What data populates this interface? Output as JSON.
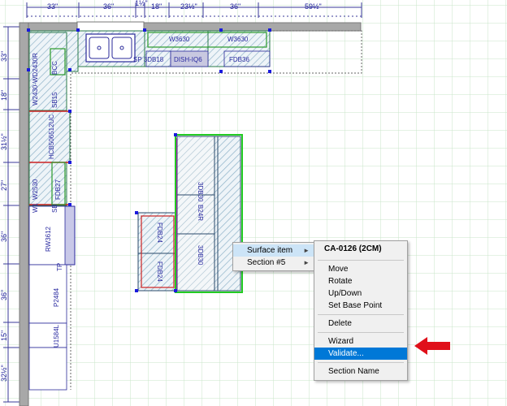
{
  "dimensions_top": [
    "33\"",
    "36\"",
    "1½\"",
    "18\"",
    "23½\"",
    "36\"",
    "59½\""
  ],
  "dimensions_left": [
    "33\"",
    "18\"",
    "31½\"",
    "27\"",
    "36\"",
    "36\"",
    "15\"",
    "32½\""
  ],
  "cabinets": {
    "wall_1": "W3630",
    "wall_2": "W3630",
    "base_1": "SP 3DB18",
    "dishwasher": "DISH-IQ6",
    "base_2": "FDB36",
    "left_wall_1": "W2430-WD2430R",
    "left_wall_2": "SB15",
    "left_wall_3": "BCC",
    "tall": "HCB506512UC",
    "left_lower_1": "W2530",
    "left_lower_2": "FDB27",
    "side_1": "W1",
    "side_2": "SB",
    "range_wall": "RW3612",
    "tp": "TP",
    "pantry": "P2484",
    "u15": "U1584L",
    "island_1": "3DB30",
    "island_2": "B24R",
    "island_3": "3DB30",
    "island_4": "FDB24",
    "island_5": "FDB24"
  },
  "context_menu": {
    "items": [
      {
        "label": "Surface item",
        "has_submenu": true
      },
      {
        "label": "Section #5",
        "has_submenu": true
      }
    ]
  },
  "submenu": {
    "title": "CA-0126 (2CM)",
    "items": [
      "Move",
      "Rotate",
      "Up/Down",
      "Set Base Point",
      "Delete",
      "Wizard",
      "Validate...",
      "Section Name"
    ],
    "highlighted": "Validate..."
  },
  "colors": {
    "grid": "#c9e6c9",
    "wall": "#a8a8a8",
    "hatch": "#8fb3c9",
    "selection_green": "#22cc22",
    "edge_red": "#cc2222",
    "edge_magenta": "#cc00cc",
    "highlight": "#0078d7",
    "arrow": "#e0101a"
  }
}
